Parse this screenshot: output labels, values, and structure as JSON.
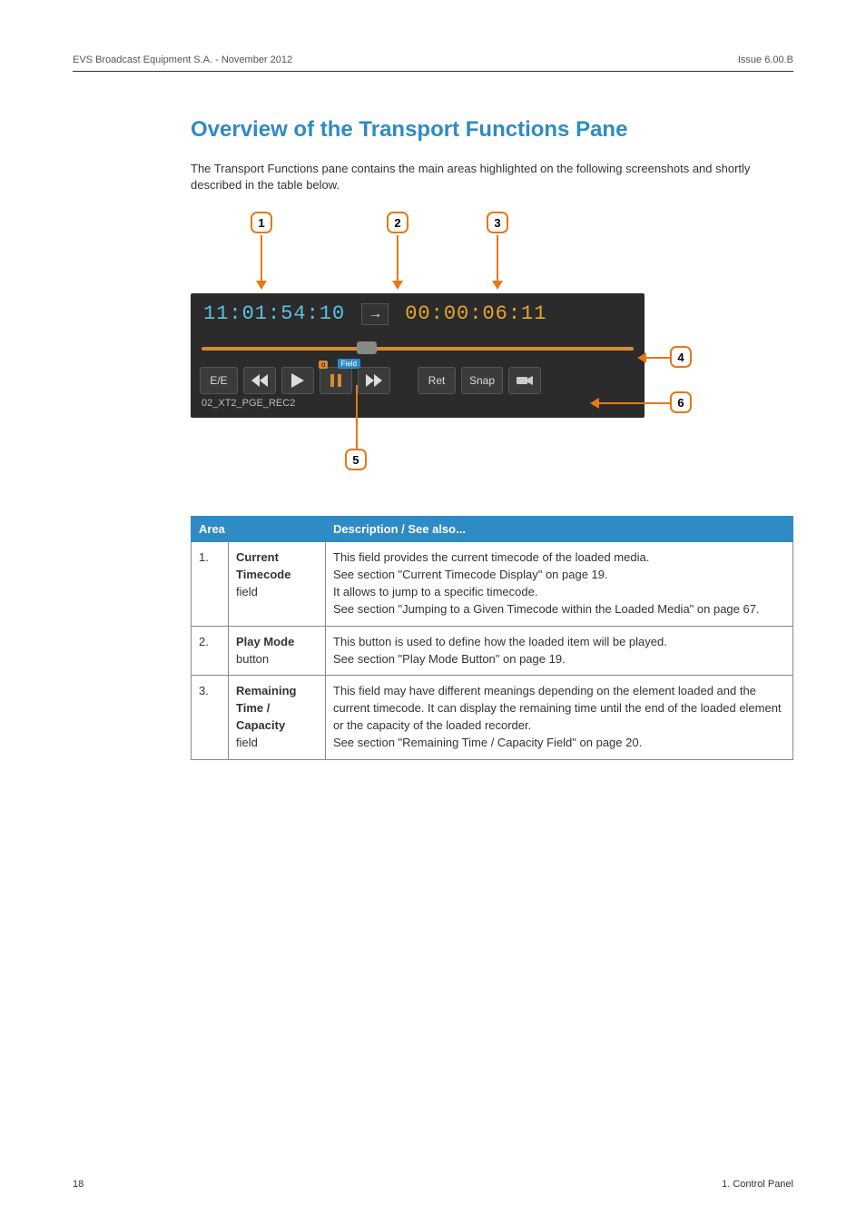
{
  "header": {
    "left": "EVS Broadcast Equipment S.A.  - November 2012",
    "right": "Issue 6.00.B"
  },
  "title": "Overview of the Transport Functions Pane",
  "intro": "The Transport Functions pane contains the main areas highlighted on the following screenshots and shortly described in the table below.",
  "callouts": {
    "c1": "1",
    "c2": "2",
    "c3": "3",
    "c4": "4",
    "c5": "5",
    "c6": "6"
  },
  "panel": {
    "current_tc": "11:01:54:10",
    "arrow": "→",
    "remaining_tc": "00:00:06:11",
    "ee": "E/E",
    "pause_o": "o",
    "pause_field": "Field",
    "ret": "Ret",
    "snap": "Snap",
    "rec_name": "02_XT2_PGE_REC2"
  },
  "table": {
    "head_area": "Area",
    "head_desc": "Description / See also...",
    "rows": [
      {
        "num": "1.",
        "label_b1": "Current",
        "label_b2": "Timecode",
        "label_plain": "field",
        "desc_l1": "This field provides the current timecode of the loaded media.",
        "desc_l2": "See section \"Current Timecode Display\" on page 19.",
        "desc_l3": "It allows to jump to a specific timecode.",
        "desc_l4": "See section \"Jumping to a Given Timecode within the Loaded Media\" on page 67."
      },
      {
        "num": "2.",
        "label_b1": "Play Mode",
        "label_plain": "button",
        "desc_l1": "This button is used to define how the loaded item will be played.",
        "desc_l2": "See section \"Play Mode Button\" on page 19."
      },
      {
        "num": "3.",
        "label_b1": "Remaining",
        "label_b2": "Time /",
        "label_b3": "Capacity",
        "label_plain": "field",
        "desc_l1": "This field may have different meanings depending on the element loaded and the current timecode. It can display the remaining time until the end of the loaded element or the capacity of the loaded recorder.",
        "desc_l2": "See section \"Remaining Time / Capacity Field\" on page 20."
      }
    ]
  },
  "footer": {
    "page": "18",
    "chapter": "1. Control Panel"
  }
}
